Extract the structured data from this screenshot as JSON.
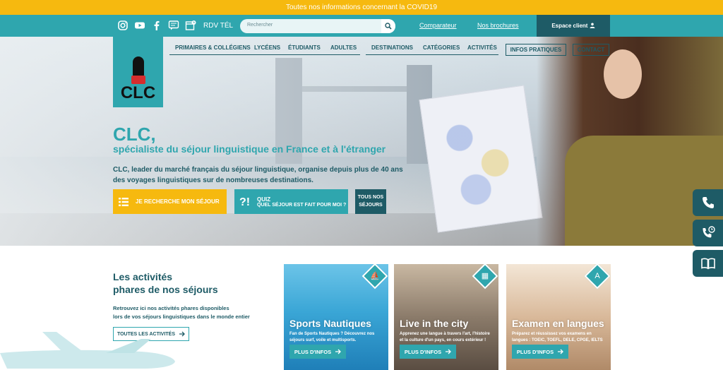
{
  "banner": {
    "text": "Toutes nos informations concernant la COVID19"
  },
  "topbar": {
    "social_icons": [
      "instagram-icon",
      "youtube-icon",
      "facebook-icon",
      "chat-icon",
      "calendar-icon"
    ],
    "rdv_label": "RDV TÉL",
    "search": {
      "placeholder": "Rechercher"
    },
    "links": {
      "comparateur": "Comparateur",
      "brochures": "Nos brochures"
    },
    "espace_client": "Espace client"
  },
  "logo": {
    "text": "CLC"
  },
  "nav": {
    "items": [
      "PRIMAIRES & COLLÉGIENS",
      "LYCÉENS",
      "ÉTUDIANTS",
      "ADULTES",
      "DESTINATIONS",
      "CATÉGORIES",
      "ACTIVITÉS"
    ],
    "boxed": [
      "INFOS PRATIQUES",
      "CONTACT"
    ]
  },
  "hero": {
    "title": "CLC,",
    "subtitle": "spécialiste du séjour linguistique en France et à l'étranger",
    "desc_line1": "CLC, leader du marché français du séjour linguistique, organise depuis plus de 40 ans",
    "desc_line2": "des voyages linguistiques sur de nombreuses destinations.",
    "cta_search": "JE RECHERCHE MON SÉJOUR",
    "cta_quiz_title": "QUIZ",
    "cta_quiz_sub": "QUEL SÉJOUR EST FAIT POUR MOI ?",
    "cta_all_line1": "TOUS NOS",
    "cta_all_line2": "SÉJOURS"
  },
  "side_buttons": [
    "phone-icon",
    "phone-clock-icon",
    "book-icon"
  ],
  "activities": {
    "title_line1": "Les activités",
    "title_line2": "phares de nos séjours",
    "desc_line1": "Retrouvez ici nos activités phares disponibles",
    "desc_line2": "lors de vos séjours linguistiques dans le monde entier",
    "button": "TOUTES LES ACTIVITÉS",
    "cards": [
      {
        "title": "Sports Nautiques",
        "text": "Fan de Sports Nautiques ? Découvrez nos séjours surf, voile et multisports.",
        "button": "PLUS D'INFOS"
      },
      {
        "title": "Live in the city",
        "text": "Apprenez une langue à travers l'art, l'histoire et la culture d'un pays, en cours extérieur !",
        "button": "PLUS D'INFOS"
      },
      {
        "title": "Examen en langues",
        "text": "Préparez et réussissez vos examens en langues : TOEIC, TOEFL, DELE, CPGE, IELTS",
        "button": "PLUS D'INFOS"
      }
    ]
  },
  "colors": {
    "teal": "#2fa6ae",
    "dark_teal": "#1e5b66",
    "yellow": "#f6b90f"
  }
}
